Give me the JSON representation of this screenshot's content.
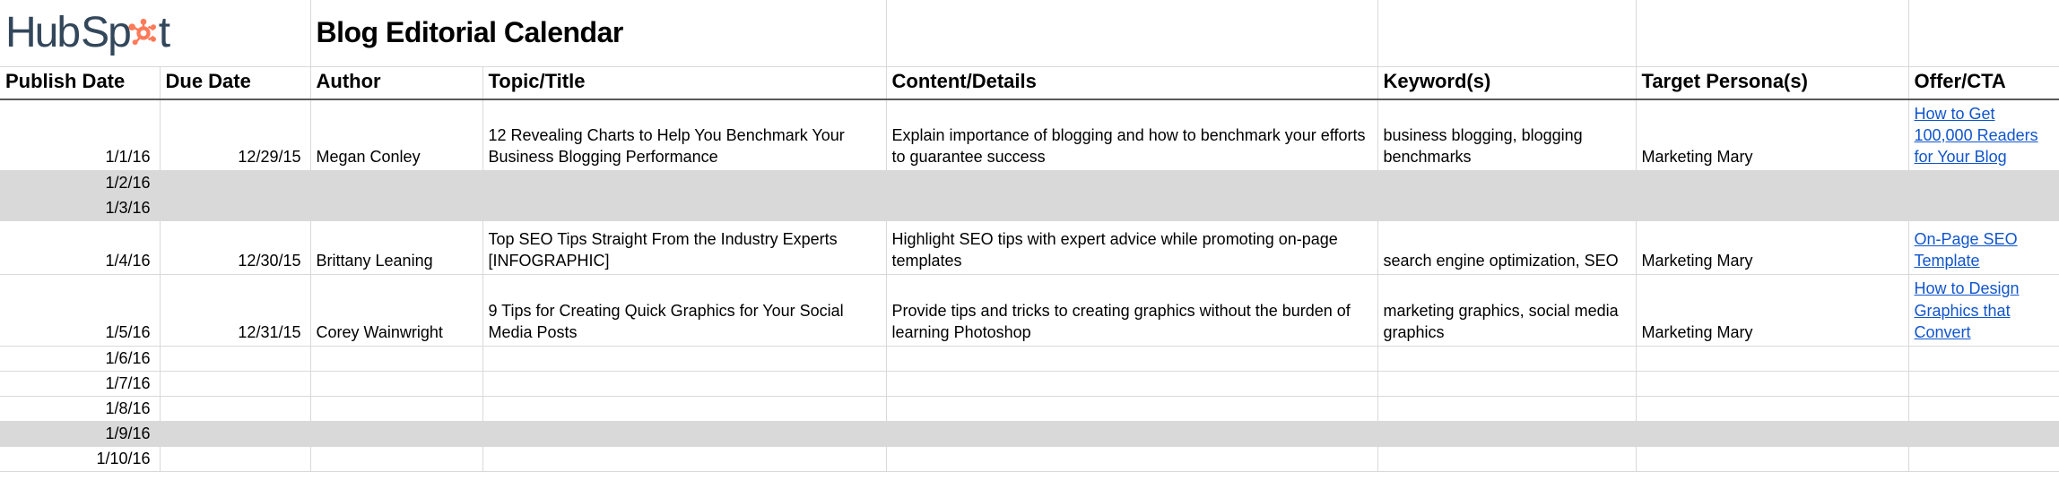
{
  "logo": {
    "part1": "Hub",
    "part2": "Sp",
    "part3": "t",
    "brand_color": "#ff7a59",
    "dark_color": "#33475b"
  },
  "title": "Blog Editorial Calendar",
  "columns": [
    "Publish Date",
    "Due Date",
    "Author",
    "Topic/Title",
    "Content/Details",
    "Keyword(s)",
    "Target Persona(s)",
    "Offer/CTA"
  ],
  "rows": [
    {
      "shaded": false,
      "type": "data",
      "publish_date": "1/1/16",
      "due_date": "12/29/15",
      "author": "Megan Conley",
      "topic": "12 Revealing Charts to Help You Benchmark Your Business Blogging Performance",
      "details": "Explain importance of blogging and how to benchmark your efforts to guarantee success",
      "keywords": "business blogging, blogging benchmarks",
      "persona": "Marketing Mary",
      "offer": "How to Get 100,000 Readers for Your Blog"
    },
    {
      "shaded": true,
      "type": "empty",
      "publish_date": "1/2/16"
    },
    {
      "shaded": true,
      "type": "empty",
      "publish_date": "1/3/16"
    },
    {
      "shaded": false,
      "type": "data",
      "publish_date": "1/4/16",
      "due_date": "12/30/15",
      "author": "Brittany Leaning",
      "topic": "Top SEO Tips Straight From the Industry Experts [INFOGRAPHIC]",
      "details": "Highlight SEO tips with expert advice while promoting on-page templates",
      "keywords": "search engine optimization, SEO",
      "persona": "Marketing Mary",
      "offer": "On-Page SEO Template"
    },
    {
      "shaded": false,
      "type": "data",
      "publish_date": "1/5/16",
      "due_date": "12/31/15",
      "author": "Corey Wainwright",
      "topic": "9 Tips for Creating Quick Graphics for Your Social Media Posts",
      "details": "Provide tips and tricks to creating graphics without the burden of learning Photoshop",
      "keywords": "marketing graphics, social media graphics",
      "persona": "Marketing Mary",
      "offer": "How to Design Graphics that Convert"
    },
    {
      "shaded": false,
      "type": "empty",
      "publish_date": "1/6/16"
    },
    {
      "shaded": false,
      "type": "empty",
      "publish_date": "1/7/16"
    },
    {
      "shaded": false,
      "type": "empty",
      "publish_date": "1/8/16"
    },
    {
      "shaded": true,
      "type": "empty",
      "publish_date": "1/9/16"
    },
    {
      "shaded": false,
      "type": "empty",
      "publish_date": "1/10/16"
    }
  ]
}
